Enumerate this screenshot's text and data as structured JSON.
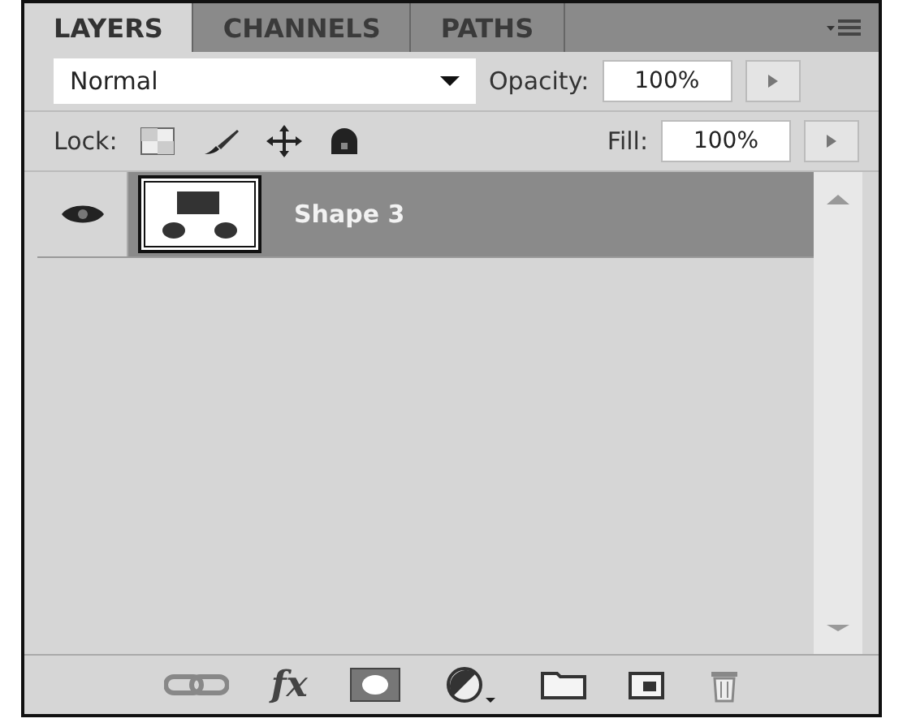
{
  "tabs": [
    {
      "label": "LAYERS",
      "selected": true
    },
    {
      "label": "CHANNELS",
      "selected": false
    },
    {
      "label": "PATHS",
      "selected": false
    }
  ],
  "blend_mode": {
    "value": "Normal"
  },
  "opacity": {
    "label": "Opacity:",
    "value": "100%"
  },
  "lock": {
    "label": "Lock:"
  },
  "fill": {
    "label": "Fill:",
    "value": "100%"
  },
  "layers": [
    {
      "name": "Shape 3",
      "selected": true,
      "visible": true
    }
  ],
  "footer": {
    "effects_label": "fx"
  }
}
